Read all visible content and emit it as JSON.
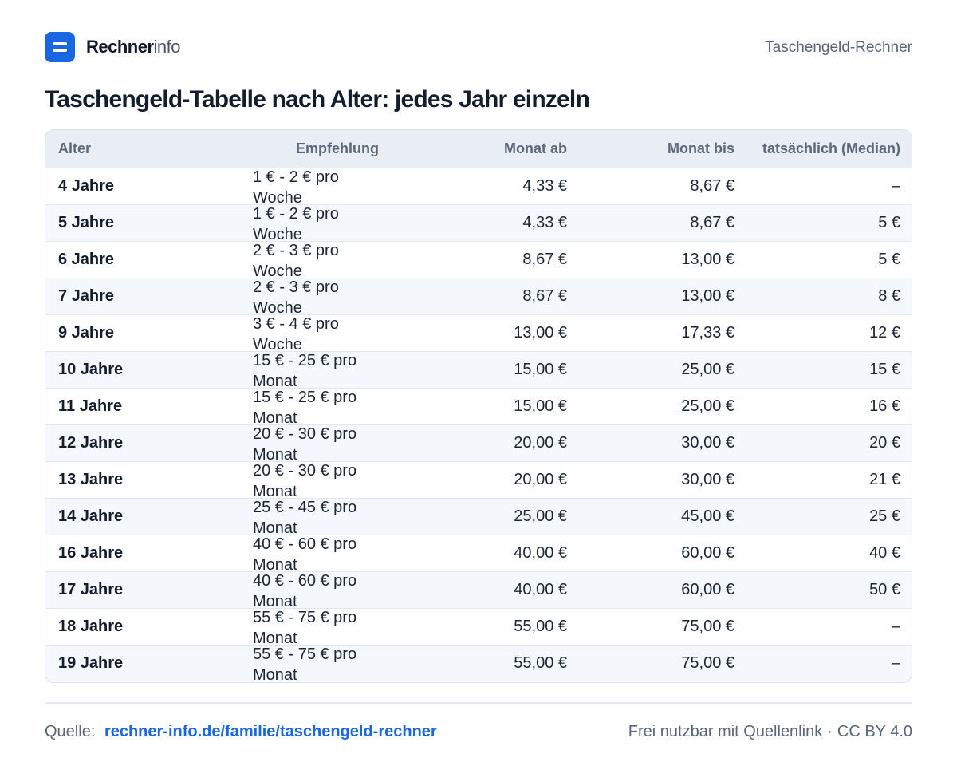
{
  "brand": {
    "name_strong": "Rechner",
    "name_light": "info"
  },
  "header": {
    "right_label": "Taschengeld-Rechner"
  },
  "title": "Taschengeld-Tabelle  nach Alter: jedes Jahr einzeln",
  "table": {
    "columns": [
      "Alter",
      "Empfehlung",
      "Monat ab",
      "Monat bis",
      "tatsächlich (Median)"
    ],
    "rows": [
      {
        "age": "4 Jahre",
        "rec": "1 € - 2 € pro Woche",
        "from": "4,33 €",
        "to": "8,67 €",
        "median": "–"
      },
      {
        "age": "5 Jahre",
        "rec": "1 € - 2 € pro Woche",
        "from": "4,33 €",
        "to": "8,67 €",
        "median": "5 €"
      },
      {
        "age": "6 Jahre",
        "rec": "2 € - 3 € pro Woche",
        "from": "8,67 €",
        "to": "13,00 €",
        "median": "5 €"
      },
      {
        "age": "7 Jahre",
        "rec": "2 € - 3 € pro Woche",
        "from": "8,67 €",
        "to": "13,00 €",
        "median": "8 €"
      },
      {
        "age": "9 Jahre",
        "rec": "3 € - 4 € pro Woche",
        "from": "13,00 €",
        "to": "17,33 €",
        "median": "12 €"
      },
      {
        "age": "10 Jahre",
        "rec": "15 € - 25 € pro Monat",
        "from": "15,00 €",
        "to": "25,00 €",
        "median": "15 €"
      },
      {
        "age": "11 Jahre",
        "rec": "15 € - 25 € pro Monat",
        "from": "15,00 €",
        "to": "25,00 €",
        "median": "16 €"
      },
      {
        "age": "12 Jahre",
        "rec": "20 € - 30 € pro Monat",
        "from": "20,00 €",
        "to": "30,00 €",
        "median": "20 €"
      },
      {
        "age": "13 Jahre",
        "rec": "20 € - 30 € pro Monat",
        "from": "20,00 €",
        "to": "30,00 €",
        "median": "21 €"
      },
      {
        "age": "14 Jahre",
        "rec": "25 € - 45 € pro Monat",
        "from": "25,00 €",
        "to": "45,00 €",
        "median": "25 €"
      },
      {
        "age": "16 Jahre",
        "rec": "40 € - 60 € pro Monat",
        "from": "40,00 €",
        "to": "60,00 €",
        "median": "40 €"
      },
      {
        "age": "17 Jahre",
        "rec": "40 € - 60 € pro Monat",
        "from": "40,00 €",
        "to": "60,00 €",
        "median": "50 €"
      },
      {
        "age": "18 Jahre",
        "rec": "55 € - 75 € pro Monat",
        "from": "55,00 €",
        "to": "75,00 €",
        "median": "–"
      },
      {
        "age": "19 Jahre",
        "rec": "55 € - 75 € pro Monat",
        "from": "55,00 €",
        "to": "75,00 €",
        "median": "–"
      }
    ]
  },
  "footer": {
    "source_label": "Quelle:",
    "source_link": "rechner-info.de/familie/taschengeld-rechner",
    "license_text": "Frei nutzbar mit Quellenlink",
    "separator": "·",
    "license": "CC BY 4.0"
  },
  "colors": {
    "accent": "#1a66e0",
    "header_bg": "#e9eef5",
    "row_alt": "#f4f7fb"
  }
}
